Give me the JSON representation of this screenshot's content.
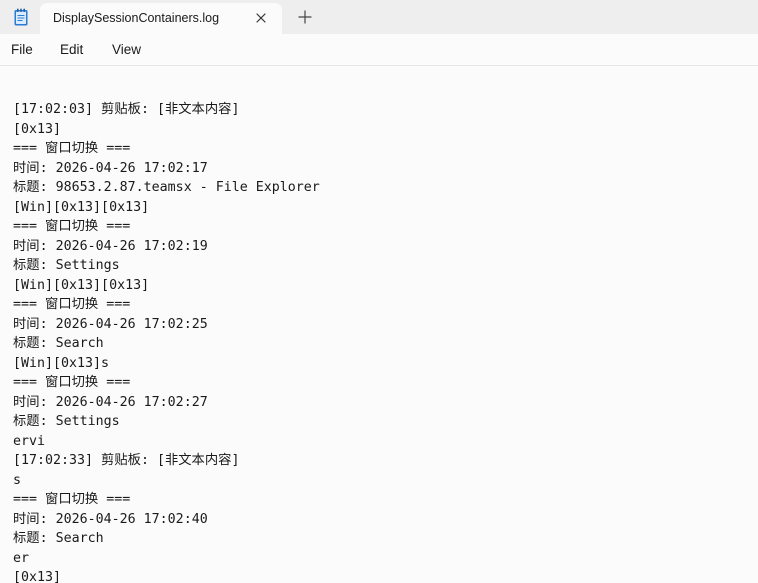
{
  "tab": {
    "title": "DisplaySessionContainers.log",
    "icon": "notepad-icon"
  },
  "menu": {
    "file": "File",
    "edit": "Edit",
    "view": "View"
  },
  "content": {
    "lines": [
      "[17:02:03] 剪贴板: [非文本内容]",
      "[0x13]",
      "=== 窗口切换 ===",
      "时间: 2026-04-26 17:02:17",
      "标题: 98653.2.87.teamsx - File Explorer",
      "[Win][0x13][0x13]",
      "=== 窗口切换 ===",
      "时间: 2026-04-26 17:02:19",
      "标题: Settings",
      "[Win][0x13][0x13]",
      "=== 窗口切换 ===",
      "时间: 2026-04-26 17:02:25",
      "标题: Search",
      "[Win][0x13]s",
      "=== 窗口切换 ===",
      "时间: 2026-04-26 17:02:27",
      "标题: Settings",
      "ervi",
      "[17:02:33] 剪贴板: [非文本内容]",
      "s",
      "=== 窗口切换 ===",
      "时间: 2026-04-26 17:02:40",
      "标题: Search",
      "er",
      "[0x13]"
    ]
  }
}
